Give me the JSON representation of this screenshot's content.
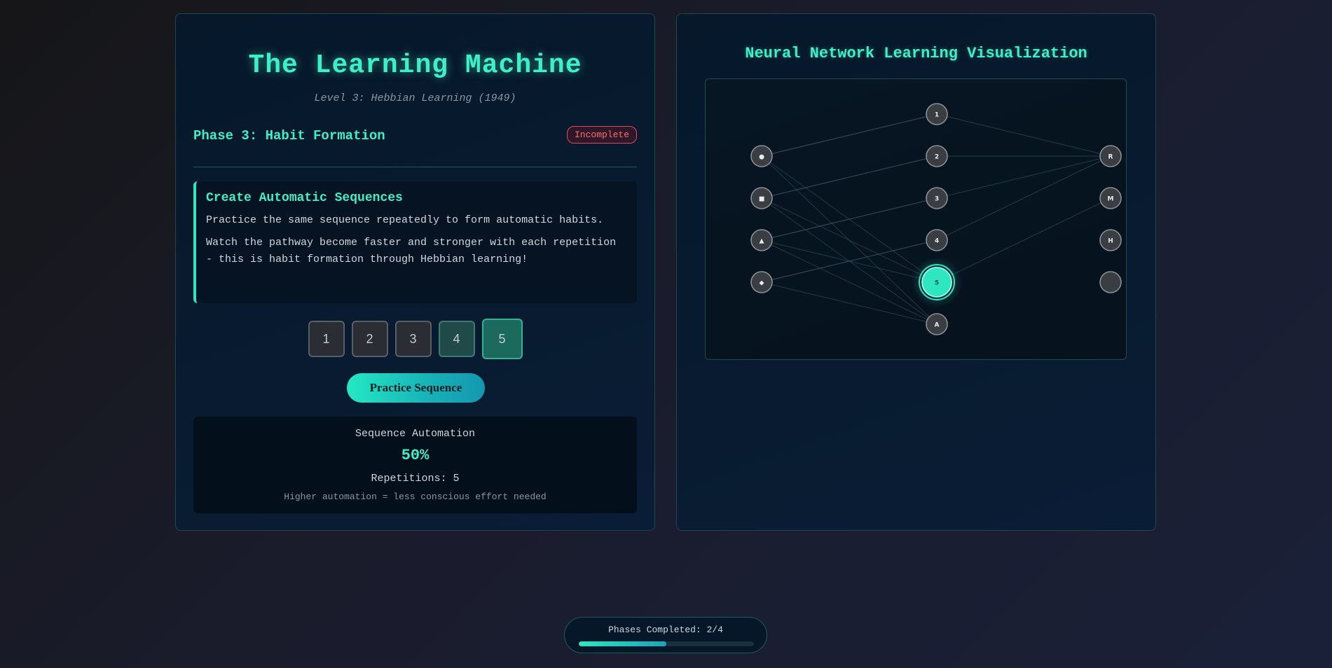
{
  "title": "The Learning Machine",
  "subtitle": "Level 3: Hebbian Learning (1949)",
  "phase": {
    "title": "Phase 3: Habit Formation",
    "status": "Incomplete"
  },
  "task": {
    "title": "Create Automatic Sequences",
    "text1": "Practice the same sequence repeatedly to form automatic habits.",
    "text2": "Watch the pathway become faster and stronger with each repetition - this is habit formation through Hebbian learning!"
  },
  "sequence_buttons": [
    "1",
    "2",
    "3",
    "4",
    "5"
  ],
  "practice_button": "Practice Sequence",
  "stats": {
    "label": "Sequence Automation",
    "value": "50%",
    "repetitions": "Repetitions: 5",
    "note": "Higher automation = less conscious effort needed"
  },
  "visualization": {
    "title": "Neural Network Learning Visualization",
    "input_nodes": [
      "●",
      "■",
      "▲",
      "◆"
    ],
    "hidden_nodes": [
      "1",
      "2",
      "3",
      "4",
      "5",
      "A"
    ],
    "output_nodes": [
      "R",
      "M",
      "H",
      ""
    ],
    "active_hidden_index": 4,
    "colors": {
      "accent": "#2ee6c0",
      "node_fill": "#3a3d42",
      "node_stroke": "#8a8f94",
      "line": "#3a5560"
    }
  },
  "progress": {
    "label": "Phases Completed: 2/4",
    "completed": 2,
    "total": 4
  }
}
